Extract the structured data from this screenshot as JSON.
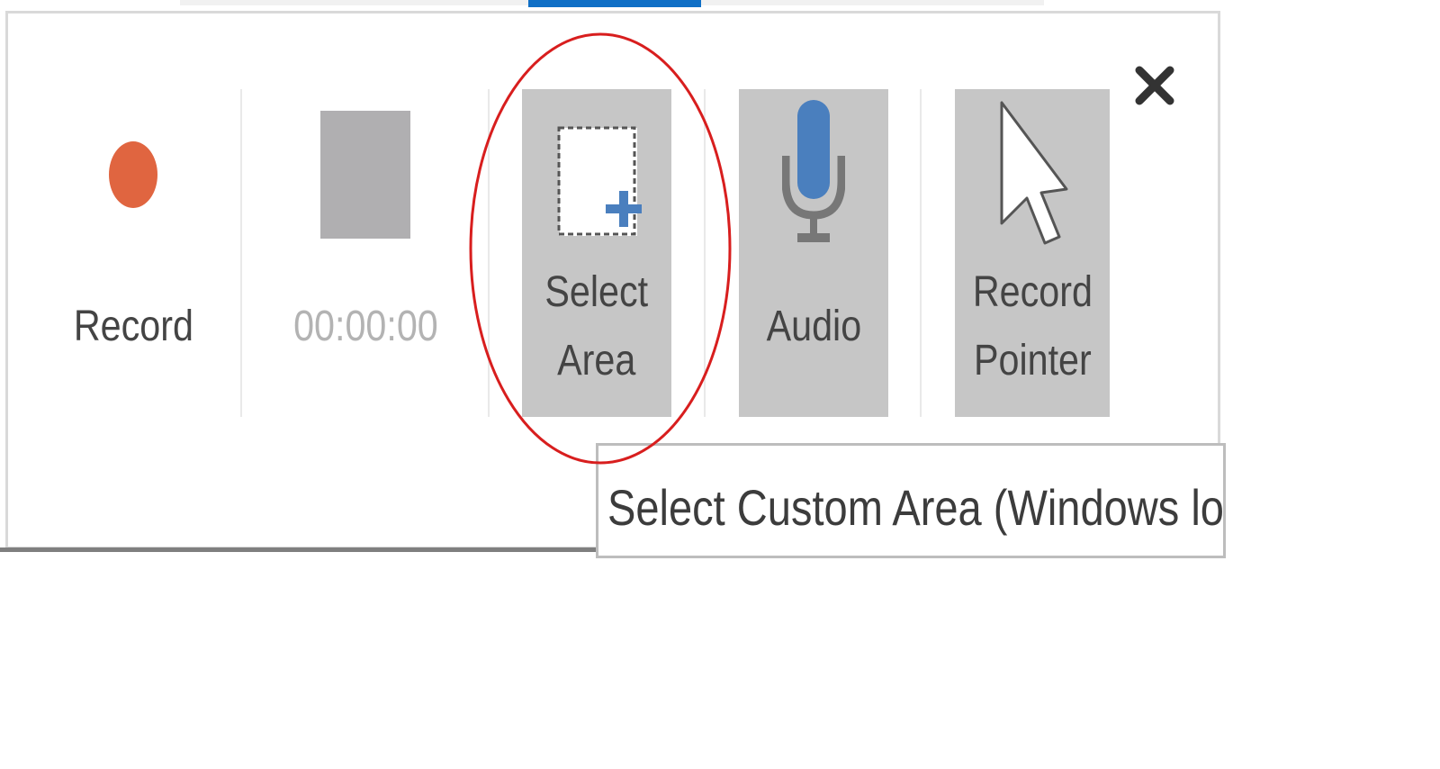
{
  "toolbar": {
    "record": {
      "label": "Record",
      "icon": "record-dot-icon"
    },
    "timer": {
      "value": "00:00:00",
      "icon": "stop-square-icon"
    },
    "select_area": {
      "label": "Select\nArea",
      "icon": "select-area-icon",
      "toggled": true
    },
    "audio": {
      "label": "Audio",
      "icon": "microphone-icon",
      "toggled": true
    },
    "record_pointer": {
      "label": "Record\nPointer",
      "icon": "pointer-cursor-icon",
      "toggled": true
    },
    "close": {
      "icon": "close-icon"
    }
  },
  "tooltip": {
    "text": "Select Custom Area (Windows lo"
  },
  "colors": {
    "record_red": "#e06540",
    "stop_gray": "#b0afb1",
    "toggle_bg": "#c6c6c6",
    "mic_blue": "#4a7fbe",
    "highlight_red": "#d81e1e",
    "accent_blue": "#0f6fc6"
  }
}
